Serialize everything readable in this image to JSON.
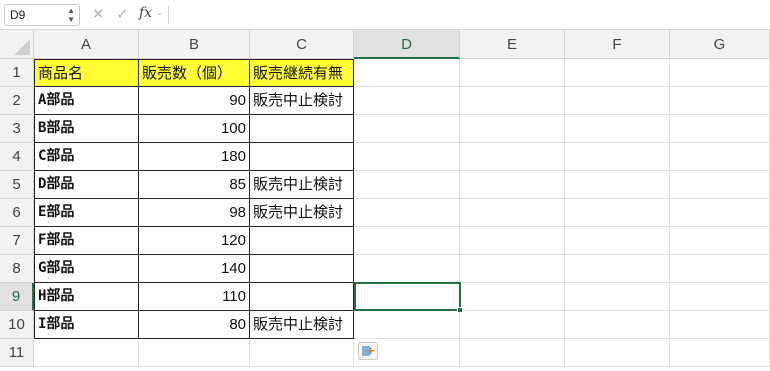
{
  "formula_bar": {
    "name_box": "D9",
    "fx_label": "fx",
    "formula_value": ""
  },
  "columns": [
    "A",
    "B",
    "C",
    "D",
    "E",
    "F",
    "G"
  ],
  "rows": [
    "1",
    "2",
    "3",
    "4",
    "5",
    "6",
    "7",
    "8",
    "9",
    "10",
    "11"
  ],
  "table": {
    "headers": [
      "商品名",
      "販売数（個）",
      "販売継続有無"
    ],
    "rows": [
      {
        "name": "A部品",
        "qty": "90",
        "status": "販売中止検討"
      },
      {
        "name": "B部品",
        "qty": "100",
        "status": ""
      },
      {
        "name": "C部品",
        "qty": "180",
        "status": ""
      },
      {
        "name": "D部品",
        "qty": "85",
        "status": "販売中止検討"
      },
      {
        "name": "E部品",
        "qty": "98",
        "status": "販売中止検討"
      },
      {
        "name": "F部品",
        "qty": "120",
        "status": ""
      },
      {
        "name": "G部品",
        "qty": "140",
        "status": ""
      },
      {
        "name": "H部品",
        "qty": "110",
        "status": ""
      },
      {
        "name": "I部品",
        "qty": "80",
        "status": "販売中止検討"
      }
    ]
  },
  "selected_cell": "D9",
  "colors": {
    "header_fill": "#ffff33",
    "selection": "#217346"
  }
}
